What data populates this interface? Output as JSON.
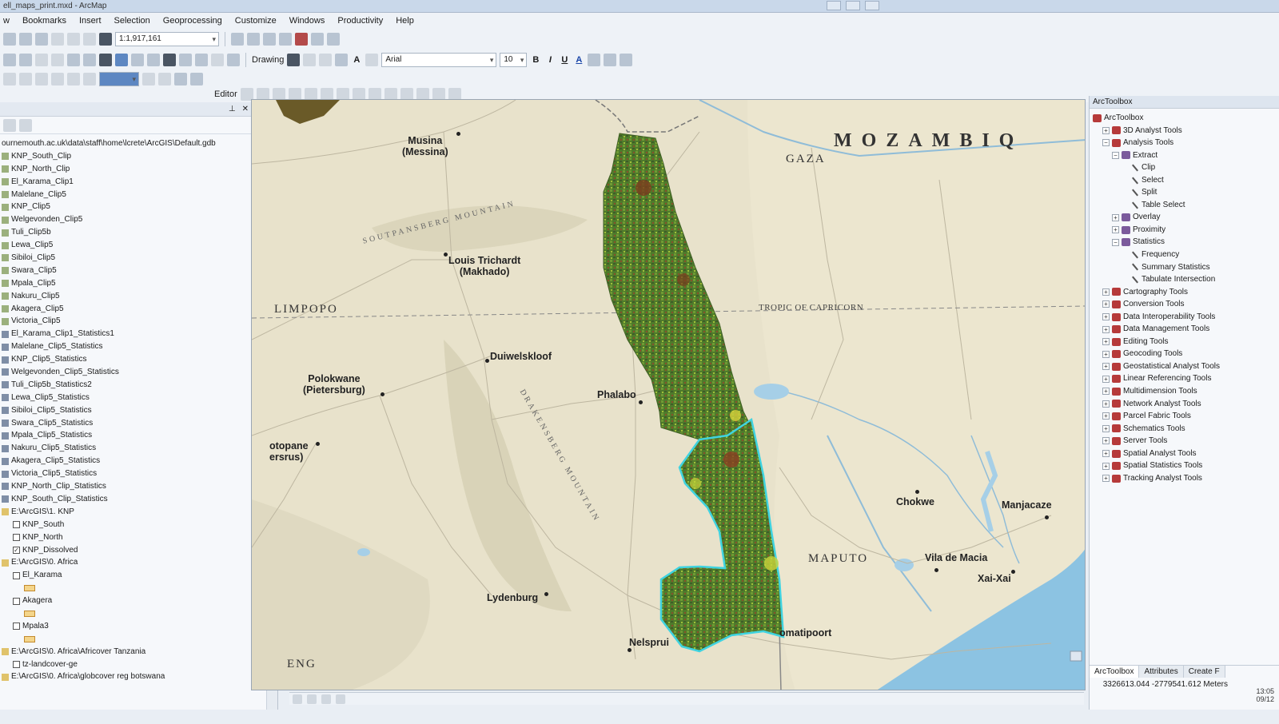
{
  "window": {
    "title": "ell_maps_print.mxd - ArcMap"
  },
  "menu": [
    "w",
    "Bookmarks",
    "Insert",
    "Selection",
    "Geoprocessing",
    "Customize",
    "Windows",
    "Productivity",
    "Help"
  ],
  "toolbar": {
    "scale": "1:1,917,161",
    "drawing_label": "Drawing",
    "font_name": "Arial",
    "font_size": "10",
    "bold": "B",
    "italic": "I",
    "underline": "U",
    "font_color": "A",
    "editor_label": "Editor"
  },
  "toc": {
    "path": "ournemouth.ac.uk\\data\\staff\\home\\lcrete\\ArcGIS\\Default.gdb",
    "items": [
      {
        "icon": "raster",
        "label": "KNP_South_Clip"
      },
      {
        "icon": "raster",
        "label": "KNP_North_Clip"
      },
      {
        "icon": "raster",
        "label": "El_Karama_Clip1"
      },
      {
        "icon": "raster",
        "label": "Malelane_Clip5"
      },
      {
        "icon": "raster",
        "label": "KNP_Clip5"
      },
      {
        "icon": "raster",
        "label": "Welgevonden_Clip5"
      },
      {
        "icon": "raster",
        "label": "Tuli_Clip5b"
      },
      {
        "icon": "raster",
        "label": "Lewa_Clip5"
      },
      {
        "icon": "raster",
        "label": "Sibiloi_Clip5"
      },
      {
        "icon": "raster",
        "label": "Swara_Clip5"
      },
      {
        "icon": "raster",
        "label": "Mpala_Clip5"
      },
      {
        "icon": "raster",
        "label": "Nakuru_Clip5"
      },
      {
        "icon": "raster",
        "label": "Akagera_Clip5"
      },
      {
        "icon": "raster",
        "label": "Victoria_Clip5"
      },
      {
        "icon": "table",
        "label": "El_Karama_Clip1_Statistics1"
      },
      {
        "icon": "table",
        "label": "Malelane_Clip5_Statistics"
      },
      {
        "icon": "table",
        "label": "KNP_Clip5_Statistics"
      },
      {
        "icon": "table",
        "label": "Welgevonden_Clip5_Statistics"
      },
      {
        "icon": "table",
        "label": "Tuli_Clip5b_Statistics2"
      },
      {
        "icon": "table",
        "label": "Lewa_Clip5_Statistics"
      },
      {
        "icon": "table",
        "label": "Sibiloi_Clip5_Statistics"
      },
      {
        "icon": "table",
        "label": "Swara_Clip5_Statistics"
      },
      {
        "icon": "table",
        "label": "Mpala_Clip5_Statistics"
      },
      {
        "icon": "table",
        "label": "Nakuru_Clip5_Statistics"
      },
      {
        "icon": "table",
        "label": "Akagera_Clip5_Statistics"
      },
      {
        "icon": "table",
        "label": "Victoria_Clip5_Statistics"
      },
      {
        "icon": "table",
        "label": "KNP_North_Clip_Statistics"
      },
      {
        "icon": "table",
        "label": "KNP_South_Clip_Statistics"
      },
      {
        "icon": "folder",
        "label": "E:\\ArcGIS\\1. KNP"
      },
      {
        "icon": "check",
        "label": "KNP_South"
      },
      {
        "icon": "check",
        "label": "KNP_North"
      },
      {
        "icon": "check-on",
        "label": "KNP_Dissolved"
      },
      {
        "icon": "folder",
        "label": "E:\\ArcGIS\\0. Africa"
      },
      {
        "icon": "check",
        "label": "El_Karama"
      },
      {
        "icon": "swatch",
        "label": ""
      },
      {
        "icon": "check",
        "label": "Akagera"
      },
      {
        "icon": "swatch",
        "label": ""
      },
      {
        "icon": "check",
        "label": "Mpala3"
      },
      {
        "icon": "swatch",
        "label": ""
      },
      {
        "icon": "folder",
        "label": "E:\\ArcGIS\\0. Africa\\Africover Tanzania"
      },
      {
        "icon": "check",
        "label": "tz-landcover-ge"
      },
      {
        "icon": "folder",
        "label": "E:\\ArcGIS\\0. Africa\\globcover reg botswana"
      }
    ]
  },
  "map": {
    "places": [
      {
        "name": "Musina\n(Messina)"
      },
      {
        "name": "Louis Trichardt\n(Makhado)"
      },
      {
        "name": "Duiwelskloof"
      },
      {
        "name": "Polokwane\n(Pietersburg)"
      },
      {
        "name": "Phalabo"
      },
      {
        "name": "otopane\nersrus)"
      },
      {
        "name": "Lydenburg"
      },
      {
        "name": "Nelsprui"
      },
      {
        "name": "omatipoort"
      },
      {
        "name": "Chokwe"
      },
      {
        "name": "Manjacaze"
      },
      {
        "name": "Vila de Macia"
      },
      {
        "name": "Xai-Xai"
      }
    ],
    "regions": {
      "mozambique": "MOZAMBIQ",
      "gaza": "GAZA",
      "limpopo": "LIMPOPO",
      "maputo": "MAPUTO",
      "eng": "ENG"
    },
    "tropic": "TROPIC OF CAPRICORN",
    "mountains": {
      "soutpansberg": "SOUTPANSBERG MOUNTAIN",
      "drakensberg": "DRAKENSBERG MOUNTAIN"
    }
  },
  "toolbox": {
    "panel_title": "ArcToolbox",
    "root": "ArcToolbox",
    "items": [
      {
        "level": 1,
        "kind": "toolbox",
        "exp": "+",
        "label": "3D Analyst Tools"
      },
      {
        "level": 1,
        "kind": "toolbox",
        "exp": "-",
        "label": "Analysis Tools"
      },
      {
        "level": 2,
        "kind": "toolset",
        "exp": "-",
        "label": "Extract"
      },
      {
        "level": 3,
        "kind": "tool",
        "exp": "",
        "label": "Clip"
      },
      {
        "level": 3,
        "kind": "tool",
        "exp": "",
        "label": "Select"
      },
      {
        "level": 3,
        "kind": "tool",
        "exp": "",
        "label": "Split"
      },
      {
        "level": 3,
        "kind": "tool",
        "exp": "",
        "label": "Table Select"
      },
      {
        "level": 2,
        "kind": "toolset",
        "exp": "+",
        "label": "Overlay"
      },
      {
        "level": 2,
        "kind": "toolset",
        "exp": "+",
        "label": "Proximity"
      },
      {
        "level": 2,
        "kind": "toolset",
        "exp": "-",
        "label": "Statistics"
      },
      {
        "level": 3,
        "kind": "tool",
        "exp": "",
        "label": "Frequency"
      },
      {
        "level": 3,
        "kind": "tool",
        "exp": "",
        "label": "Summary Statistics"
      },
      {
        "level": 3,
        "kind": "tool",
        "exp": "",
        "label": "Tabulate Intersection"
      },
      {
        "level": 1,
        "kind": "toolbox",
        "exp": "+",
        "label": "Cartography Tools"
      },
      {
        "level": 1,
        "kind": "toolbox",
        "exp": "+",
        "label": "Conversion Tools"
      },
      {
        "level": 1,
        "kind": "toolbox",
        "exp": "+",
        "label": "Data Interoperability Tools"
      },
      {
        "level": 1,
        "kind": "toolbox",
        "exp": "+",
        "label": "Data Management Tools"
      },
      {
        "level": 1,
        "kind": "toolbox",
        "exp": "+",
        "label": "Editing Tools"
      },
      {
        "level": 1,
        "kind": "toolbox",
        "exp": "+",
        "label": "Geocoding Tools"
      },
      {
        "level": 1,
        "kind": "toolbox",
        "exp": "+",
        "label": "Geostatistical Analyst Tools"
      },
      {
        "level": 1,
        "kind": "toolbox",
        "exp": "+",
        "label": "Linear Referencing Tools"
      },
      {
        "level": 1,
        "kind": "toolbox",
        "exp": "+",
        "label": "Multidimension Tools"
      },
      {
        "level": 1,
        "kind": "toolbox",
        "exp": "+",
        "label": "Network Analyst Tools"
      },
      {
        "level": 1,
        "kind": "toolbox",
        "exp": "+",
        "label": "Parcel Fabric Tools"
      },
      {
        "level": 1,
        "kind": "toolbox",
        "exp": "+",
        "label": "Schematics Tools"
      },
      {
        "level": 1,
        "kind": "toolbox",
        "exp": "+",
        "label": "Server Tools"
      },
      {
        "level": 1,
        "kind": "toolbox",
        "exp": "+",
        "label": "Spatial Analyst Tools"
      },
      {
        "level": 1,
        "kind": "toolbox",
        "exp": "+",
        "label": "Spatial Statistics Tools"
      },
      {
        "level": 1,
        "kind": "toolbox",
        "exp": "+",
        "label": "Tracking Analyst Tools"
      }
    ],
    "tabs": [
      "ArcToolbox",
      "Attributes",
      "Create F"
    ]
  },
  "status": {
    "coordinates": "3326613.044  -2779541.612 Meters",
    "time": "13:05",
    "date": "09/12"
  },
  "colors": {
    "accent": "#5d87c2",
    "park_fill": "#4e7a2c",
    "park_outline_cyan": "#3fd3e0",
    "ocean": "#8fc6e4",
    "land": "#e6dfc6"
  }
}
